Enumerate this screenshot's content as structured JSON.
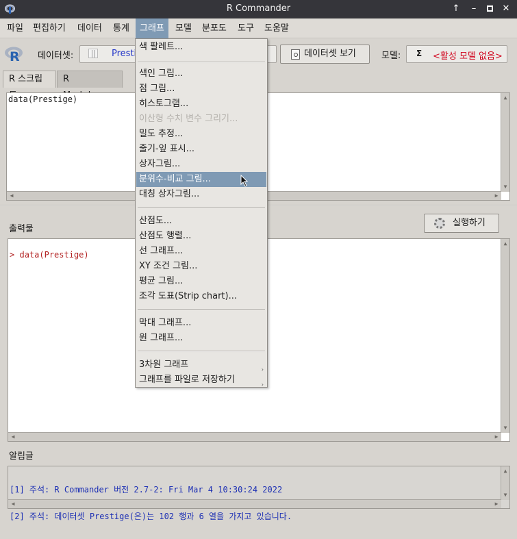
{
  "window": {
    "title": "R Commander",
    "buttons": [
      "↑",
      "–",
      "▫",
      "✕"
    ]
  },
  "menubar": {
    "items": [
      "파일",
      "편집하기",
      "데이터",
      "통계",
      "그래프",
      "모델",
      "분포도",
      "도구",
      "도움말"
    ],
    "active": "그래프"
  },
  "toolbar": {
    "dataset_label": "데이터셋:",
    "dataset_value": "Prestige",
    "view_dataset_button": "데이터셋 보기",
    "model_label": "모델:",
    "model_sigma": "Σ",
    "model_value": "<활성 모델 없음>",
    "model_color": "#d0021b"
  },
  "tabs": {
    "r_script": "R 스크립트",
    "r_markdown": "R Markdown"
  },
  "script": {
    "content": "data(Prestige)"
  },
  "output": {
    "label": "출력물",
    "run_button": "실행하기",
    "prompt": ">",
    "content": "data(Prestige)",
    "prompt_color": "#b22222"
  },
  "messages": {
    "label": "알림글",
    "lines": [
      "[1] 주석: R Commander 버전 2.7-2: Fri Mar 4 10:30:24 2022",
      "[2] 주석: 데이터셋 Prestige(은)는 102 행과 6 열을 가지고 있습니다."
    ],
    "text_color": "#1c2fb4"
  },
  "graph_menu": {
    "items": [
      "색 팔레트...",
      "색인 그림...",
      "점 그림...",
      "히스토그램...",
      "이산형 수치 변수 그리기...",
      "밀도 추정...",
      "줄기-잎 표시...",
      "상자그림...",
      "분위수-비교 그림...",
      "대칭 상자그림...",
      "산점도...",
      "산점도 행렬...",
      "선 그래프...",
      "XY 조건 그림...",
      "평균 그림...",
      "조각 도표(Strip chart)...",
      "막대 그래프...",
      "원 그래프...",
      "3차원 그래프",
      "그래프를 파일로 저장하기"
    ],
    "disabled": "이산형 수치 변수 그리기...",
    "highlighted": "분위수-비교 그림...",
    "submenu_mark": "›"
  }
}
